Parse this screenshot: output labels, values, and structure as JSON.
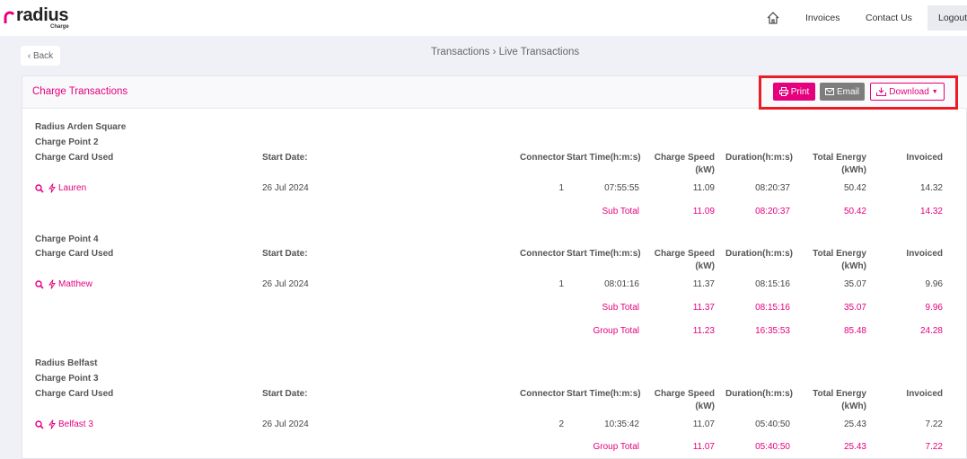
{
  "brand": {
    "name": "radius",
    "sub": "Charge"
  },
  "nav": {
    "invoices": "Invoices",
    "contact": "Contact Us",
    "logout": "Logout"
  },
  "back_label": "Back",
  "breadcrumb": "Transactions › Live Transactions",
  "card": {
    "title": "Charge Transactions"
  },
  "buttons": {
    "print": "Print",
    "email": "Email",
    "download": "Download"
  },
  "headers": {
    "card": "Charge Card Used",
    "start_date": "Start Date:",
    "connector": "Connector",
    "start_time": "Start Time(h:m:s)",
    "speed_1": "Charge Speed",
    "speed_2": "(kW)",
    "duration": "Duration(h:m:s)",
    "energy_1": "Total Energy",
    "energy_2": "(kWh)",
    "invoiced": "Invoiced"
  },
  "labels": {
    "sub_total": "Sub Total",
    "group_total": "Group Total"
  },
  "g1": {
    "name": "Radius Arden Square",
    "cp1": {
      "name": "Charge Point 2",
      "card": "Lauren",
      "date": "26 Jul 2024",
      "connector": "1",
      "time": "07:55:55",
      "speed": "11.09",
      "duration": "08:20:37",
      "energy": "50.42",
      "invoiced": "14.32",
      "sub": {
        "speed": "11.09",
        "duration": "08:20:37",
        "energy": "50.42",
        "invoiced": "14.32"
      }
    },
    "cp2": {
      "name": "Charge Point 4",
      "card": "Matthew",
      "date": "26 Jul 2024",
      "connector": "1",
      "time": "08:01:16",
      "speed": "11.37",
      "duration": "08:15:16",
      "energy": "35.07",
      "invoiced": "9.96",
      "sub": {
        "speed": "11.37",
        "duration": "08:15:16",
        "energy": "35.07",
        "invoiced": "9.96"
      }
    },
    "group": {
      "speed": "11.23",
      "duration": "16:35:53",
      "energy": "85.48",
      "invoiced": "24.28"
    }
  },
  "g2": {
    "name": "Radius Belfast",
    "cp1": {
      "name": "Charge Point 3",
      "card": "Belfast 3",
      "date": "26 Jul 2024",
      "connector": "2",
      "time": "10:35:42",
      "speed": "11.07",
      "duration": "05:40:50",
      "energy": "25.43",
      "invoiced": "7.22"
    },
    "group": {
      "speed": "11.07",
      "duration": "05:40:50",
      "energy": "25.43",
      "invoiced": "7.22"
    }
  }
}
